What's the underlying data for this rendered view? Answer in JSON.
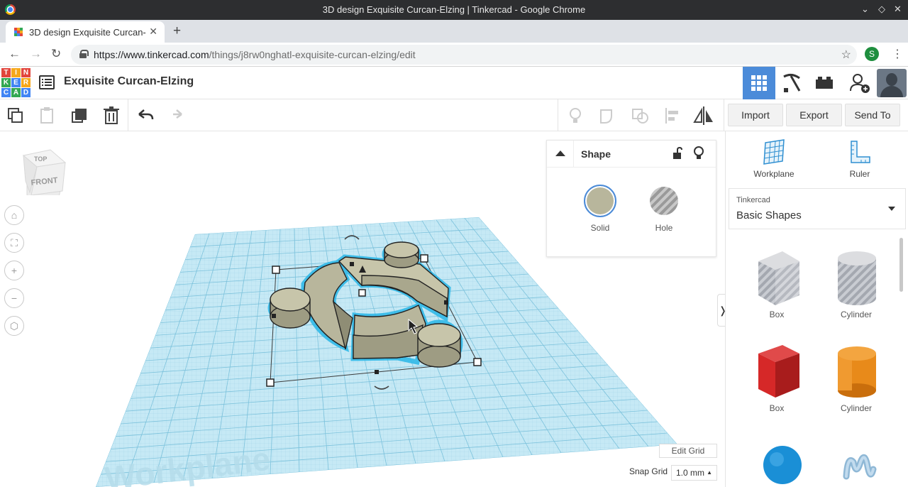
{
  "browser": {
    "window_title": "3D design Exquisite Curcan-Elzing | Tinkercad - Google Chrome",
    "tab_title": "3D design Exquisite Curcan-El",
    "url_host": "https://www.tinkercad.com",
    "url_path": "/things/j8rw0nghatl-exquisite-curcan-elzing/edit",
    "profile_initial": "S"
  },
  "header": {
    "logo_letters": [
      "TIN",
      "KER",
      "CAD"
    ],
    "project_title": "Exquisite Curcan-Elzing"
  },
  "toolbar": {
    "import_label": "Import",
    "export_label": "Export",
    "send_to_label": "Send To"
  },
  "viewcube": {
    "top_label": "TOP",
    "front_label": "FRONT"
  },
  "workplane": {
    "watermark": "Workplane",
    "edit_grid_label": "Edit Grid",
    "snap_grid_label": "Snap Grid",
    "snap_grid_value": "1.0 mm"
  },
  "shape_panel": {
    "title": "Shape",
    "solid_label": "Solid",
    "hole_label": "Hole"
  },
  "sidebar": {
    "workplane_label": "Workplane",
    "ruler_label": "Ruler",
    "library_source": "Tinkercad",
    "library_name": "Basic Shapes",
    "shapes": [
      {
        "label": "Box",
        "style": "hole-box"
      },
      {
        "label": "Cylinder",
        "style": "hole-cylinder"
      },
      {
        "label": "Box",
        "style": "red-box"
      },
      {
        "label": "Cylinder",
        "style": "orange-cylinder"
      }
    ]
  },
  "colors": {
    "accent": "#4b8bd9",
    "shape": "#b8b69c",
    "grid": "#b4e2f0",
    "box_red": "#d62828",
    "cyl_orange": "#e88a1a",
    "sphere_blue": "#1a8fd6"
  }
}
